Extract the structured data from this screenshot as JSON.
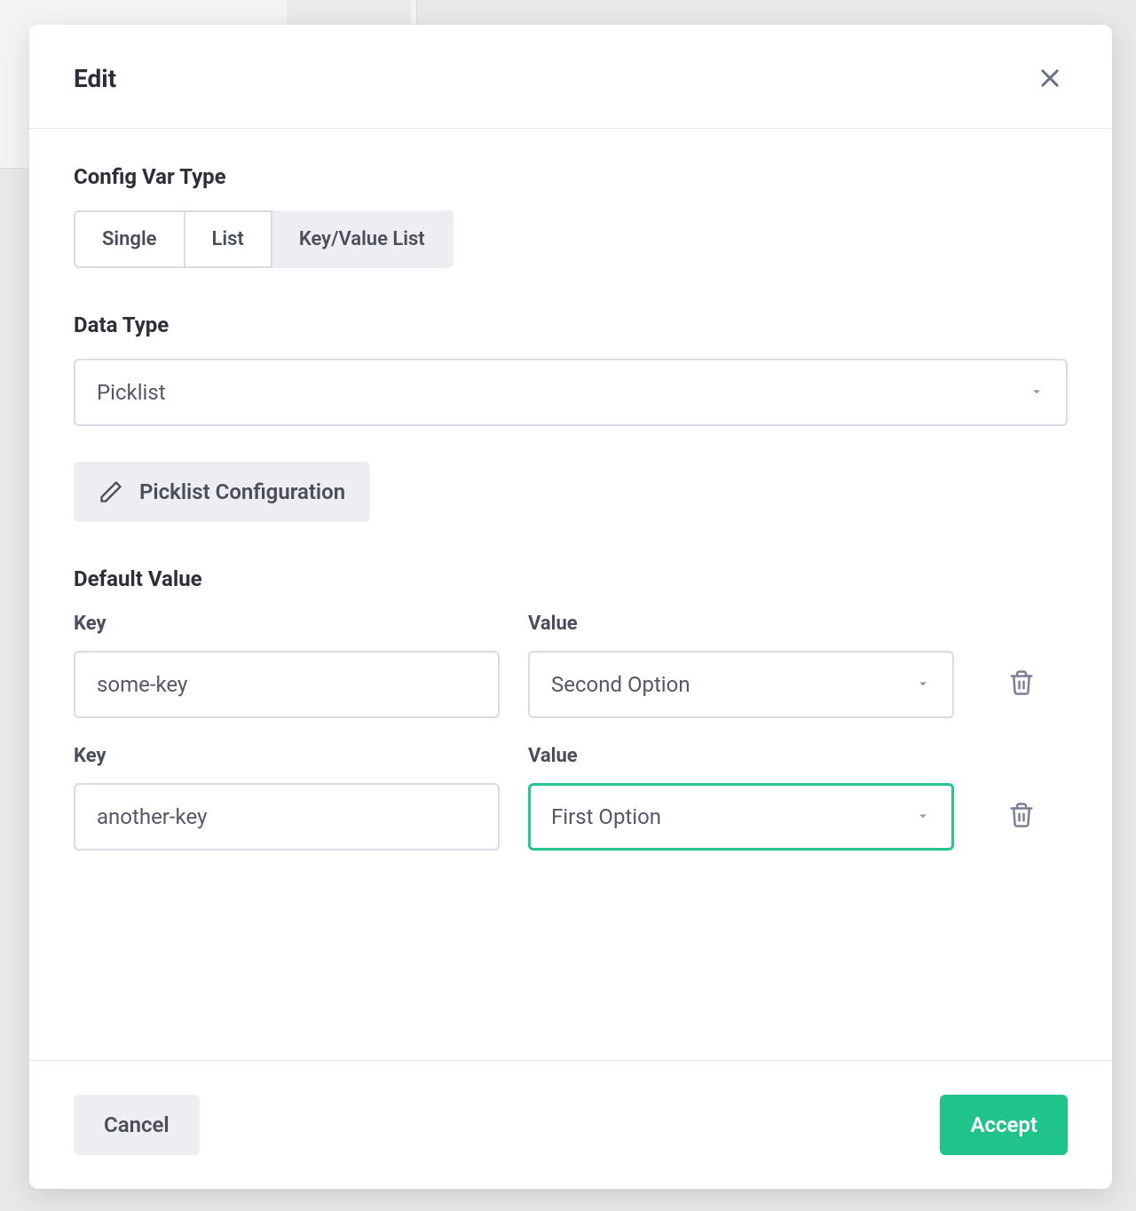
{
  "header": {
    "title": "Edit"
  },
  "config_var_type": {
    "label": "Config Var Type",
    "options": [
      "Single",
      "List",
      "Key/Value List"
    ],
    "selected_index": 2
  },
  "data_type": {
    "label": "Data Type",
    "value": "Picklist"
  },
  "picklist_config": {
    "label": "Picklist Configuration"
  },
  "default_value": {
    "label": "Default Value",
    "key_label": "Key",
    "value_label": "Value",
    "rows": [
      {
        "key": "some-key",
        "value": "Second Option",
        "focused": false
      },
      {
        "key": "another-key",
        "value": "First Option",
        "focused": true
      }
    ]
  },
  "footer": {
    "cancel": "Cancel",
    "accept": "Accept"
  },
  "colors": {
    "accent": "#20c48a",
    "focus": "#27c590"
  }
}
